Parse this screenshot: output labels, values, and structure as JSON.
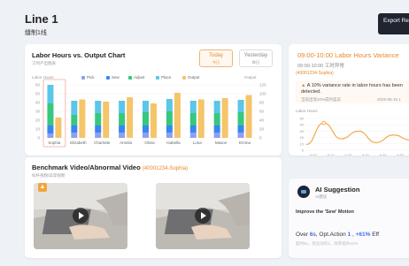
{
  "header": {
    "title": "Line 1",
    "subtitle": "缝制1线",
    "export_label": "Export Re"
  },
  "labor_chart": {
    "title": "Labor Hours vs. Output Chart",
    "subtitle": "工时产出图表",
    "toggle_today": "Today",
    "toggle_today_sub": "今日",
    "toggle_yesterday": "Yesterday",
    "toggle_yesterday_sub": "昨日",
    "left_axis_label": "Labor Hours",
    "right_axis_label": "Output",
    "legend": [
      {
        "label": "Pick",
        "color": "#8f9ff0"
      },
      {
        "label": "Sew",
        "color": "#3a86f0"
      },
      {
        "label": "Adjust",
        "color": "#37c77d"
      },
      {
        "label": "Place",
        "color": "#5bc6e8"
      },
      {
        "label": "Output",
        "color": "#f5c56a"
      }
    ]
  },
  "chart_data": {
    "type": "bar",
    "categories": [
      "Sophia",
      "Elizabeth",
      "Charlotte",
      "Amelia",
      "Olivia",
      "Isabella",
      "Luna",
      "Mason",
      "Emma"
    ],
    "series": [
      {
        "name": "Pick",
        "values": [
          5,
          6,
          6,
          6,
          6,
          6,
          6,
          6,
          6
        ]
      },
      {
        "name": "Sew",
        "values": [
          9,
          8,
          8,
          8,
          8,
          8,
          8,
          8,
          8
        ]
      },
      {
        "name": "Adjust",
        "values": [
          25,
          12,
          14,
          14,
          15,
          16,
          14,
          14,
          15
        ]
      },
      {
        "name": "Place",
        "values": [
          21,
          16,
          14,
          14,
          13,
          14,
          14,
          14,
          14
        ]
      },
      {
        "name": "Output",
        "values": [
          46,
          87,
          82,
          92,
          78,
          102,
          87,
          90,
          97
        ]
      }
    ],
    "left_ticks": [
      0,
      10,
      20,
      30,
      40,
      50,
      60
    ],
    "right_ticks": [
      0,
      20,
      40,
      60,
      80,
      100,
      120
    ],
    "ylim": [
      0,
      60
    ],
    "y2lim": [
      0,
      120
    ],
    "xlabel": "",
    "ylabel": "Labor Hours",
    "y2label": "Output",
    "highlight": "Sophia"
  },
  "video": {
    "title": "Benchmark Video/Abnormal Video",
    "tag": "(40001234-Sophia)",
    "subtitle": "标杆视频/异常视频",
    "badge_icon": "thumbs-up-icon"
  },
  "variance": {
    "title": "09:00-10:00 Labor Hours Variance",
    "subtitle": "09:00-10:00 工时异常",
    "tag": "(40001234-Sophia)",
    "alert_text": "A 10% variance rate in labor hours has been detected.",
    "alert_meta": "当前出现10%成时差异",
    "alert_date": "2025-06-15 1",
    "axis_label": "Labor Hours",
    "line_data": {
      "type": "line",
      "x": [
        "9:00",
        "9:10",
        "9:20",
        "9:30",
        "9:40",
        "9:50"
      ],
      "y_ticks": [
        0,
        10,
        20,
        30,
        40,
        50
      ],
      "ylim": [
        0,
        50
      ],
      "values": [
        9,
        43,
        18,
        30,
        12,
        24,
        16
      ],
      "color": "#f5a94a"
    }
  },
  "ai": {
    "title": "AI Suggestion",
    "subtitle": "AI建议",
    "point": "Improve the 'Sew' Motion",
    "metric_prefix": "Over",
    "metric_seconds": "6",
    "metric_mid": "s, Opt.Action",
    "metric_action": "1",
    "metric_gain": "+61%",
    "metric_suffix": "Eff",
    "note": "超时6s，优化动作1，效率提升61%"
  }
}
